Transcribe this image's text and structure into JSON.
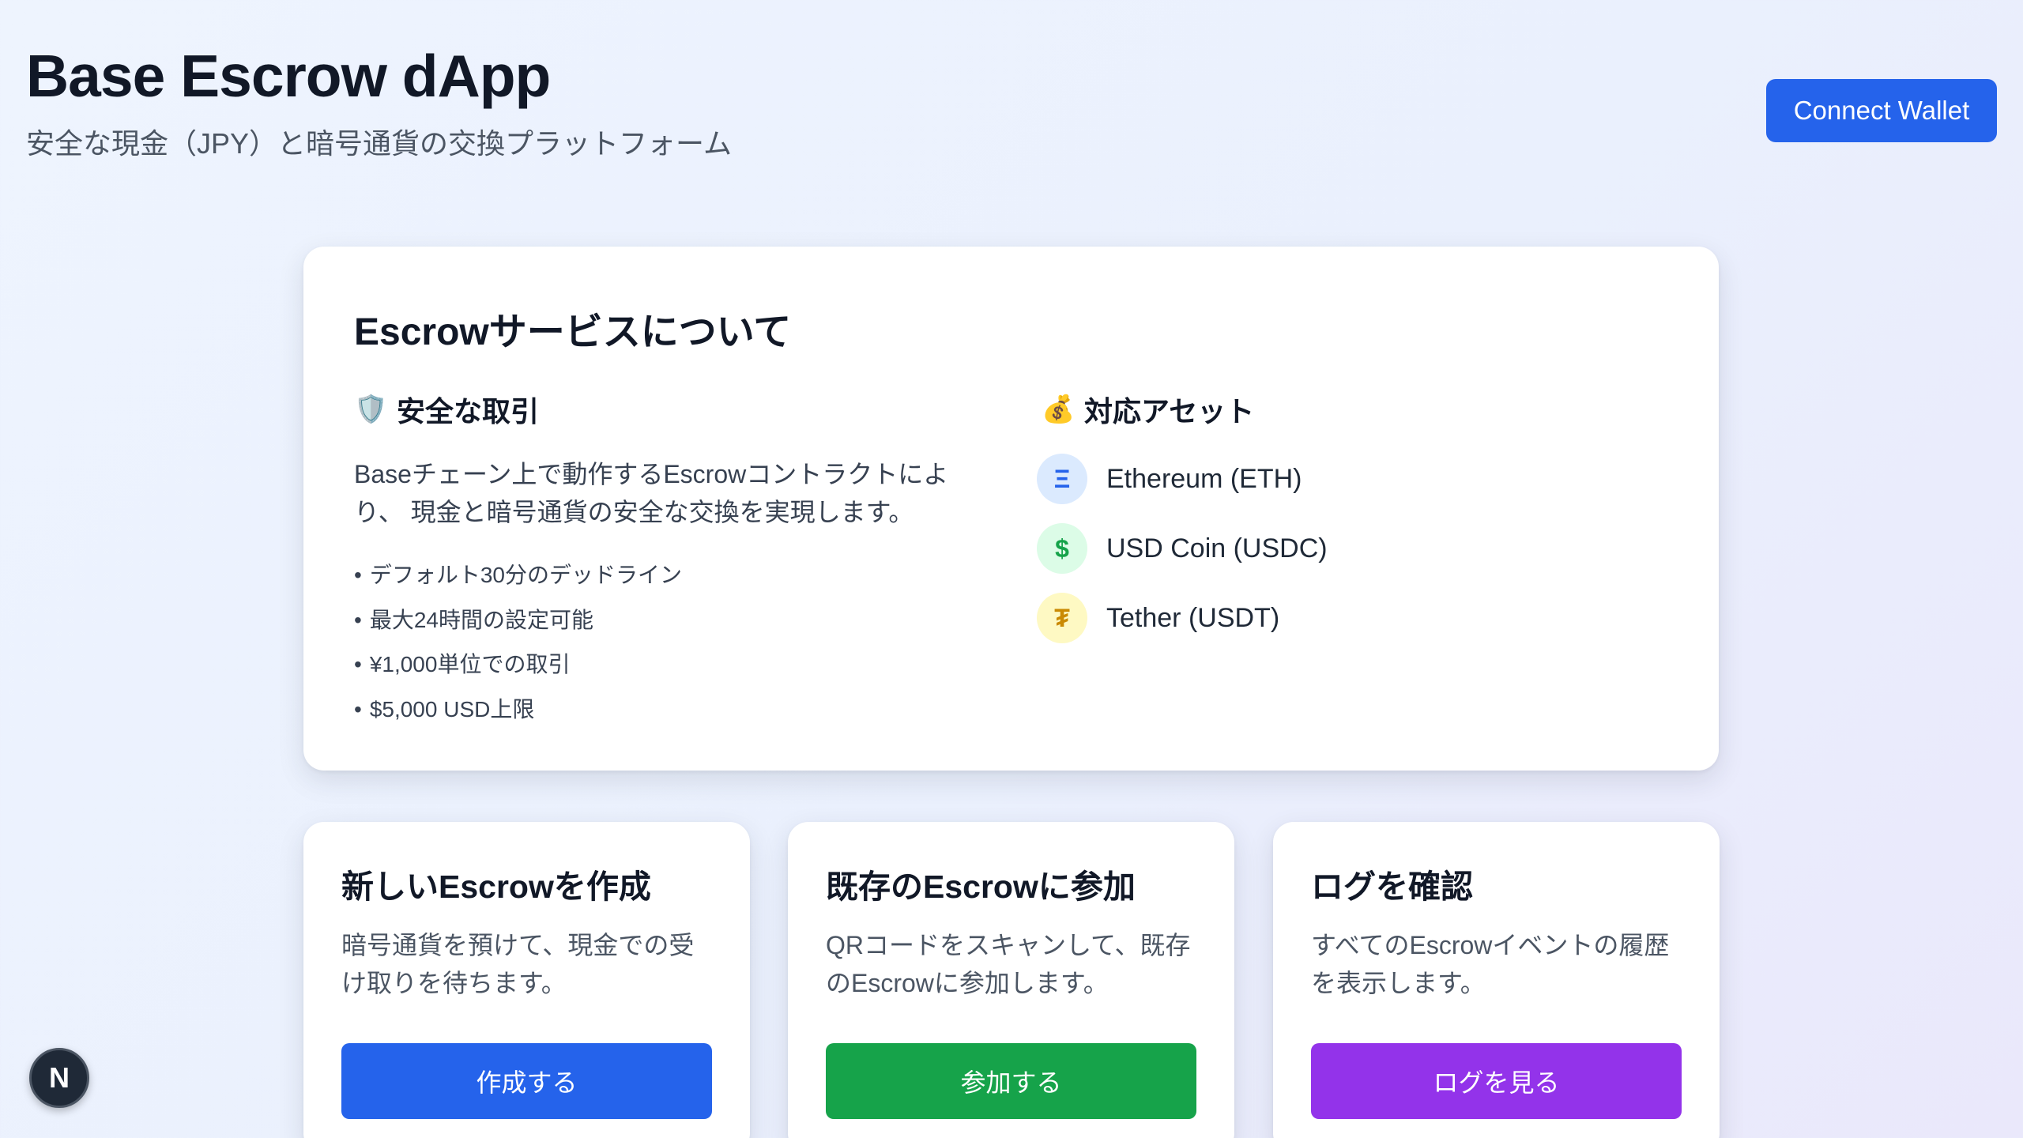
{
  "header": {
    "title": "Base Escrow dApp",
    "subtitle": "安全な現金（JPY）と暗号通貨の交換プラットフォーム",
    "connect_label": "Connect Wallet"
  },
  "about": {
    "title": "Escrowサービスについて",
    "safe": {
      "icon": "shield-icon",
      "emoji": "🛡️",
      "heading": "安全な取引",
      "description": "Baseチェーン上で動作するEscrowコントラクトにより、 現金と暗号通貨の安全な交換を実現します。",
      "features": [
        "デフォルト30分のデッドライン",
        "最大24時間の設定可能",
        "¥1,000単位での取引",
        "$5,000 USD上限"
      ]
    },
    "assets": {
      "icon": "money-bag-icon",
      "emoji": "💰",
      "heading": "対応アセット",
      "items": [
        {
          "label": "Ethereum (ETH)",
          "icon": "ethereum-icon",
          "symbol": "Ξ",
          "bg": "#dbeafe",
          "fg": "#2563eb"
        },
        {
          "label": "USD Coin (USDC)",
          "icon": "dollar-icon",
          "symbol": "$",
          "bg": "#dcfce7",
          "fg": "#16a34a"
        },
        {
          "label": "Tether (USDT)",
          "icon": "tether-icon",
          "symbol": "₮",
          "bg": "#fef9c3",
          "fg": "#ca8a04"
        }
      ]
    }
  },
  "actions": [
    {
      "title": "新しいEscrowを作成",
      "description": "暗号通貨を預けて、現金での受け取りを待ちます。",
      "button": "作成する",
      "color": "#2563eb"
    },
    {
      "title": "既存のEscrowに参加",
      "description": "QRコードをスキャンして、既存のEscrowに参加します。",
      "button": "参加する",
      "color": "#16a34a"
    },
    {
      "title": "ログを確認",
      "description": "すべてのEscrowイベントの履歴を表示します。",
      "button": "ログを見る",
      "color": "#9333ea"
    }
  ],
  "badge": {
    "letter": "N",
    "icon": "nextjs-icon"
  },
  "colors": {
    "primary": "#2563eb",
    "success": "#16a34a",
    "purple": "#9333ea",
    "text": "#111827",
    "muted": "#4b5563"
  }
}
